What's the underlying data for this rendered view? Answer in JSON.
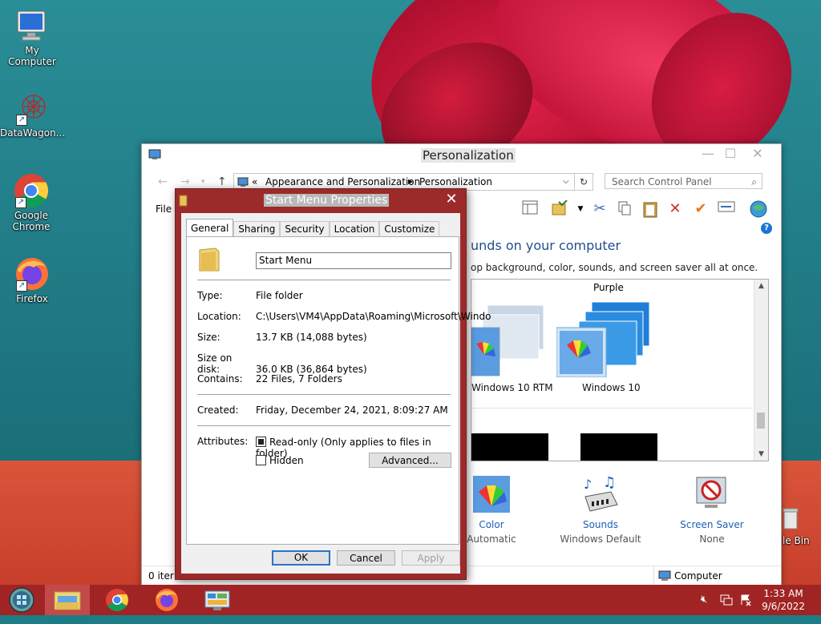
{
  "desktop": {
    "icons": [
      {
        "label": "My Computer"
      },
      {
        "label": "DataWagon..."
      },
      {
        "label": "Google Chrome"
      },
      {
        "label": "Firefox"
      }
    ],
    "recycle_bin_label": "le Bin"
  },
  "control_panel": {
    "title": "Personalization",
    "breadcrumb": {
      "prefix": "«",
      "parts": [
        "Appearance and Personalization",
        "Personalization"
      ]
    },
    "search_placeholder": "Search Control Panel",
    "file_menu": "File",
    "heading": "unds on your computer",
    "subheading": "op background, color, sounds, and screen saver all at once.",
    "theme_group_label": "Purple",
    "themes": [
      "Windows 10 RTM",
      "Windows 10"
    ],
    "bottom_items": [
      {
        "name": "Color",
        "value": "Automatic"
      },
      {
        "name": "Sounds",
        "value": "Windows Default"
      },
      {
        "name": "Screen Saver",
        "value": "None"
      }
    ],
    "status_left": "0 iter",
    "status_right": "Computer"
  },
  "dialog": {
    "title": "Start Menu Properties",
    "tabs": [
      "General",
      "Sharing",
      "Security",
      "Location",
      "Customize"
    ],
    "folder_name": "Start Menu",
    "fields": {
      "type_label": "Type:",
      "type_value": "File folder",
      "location_label": "Location:",
      "location_value": "C:\\Users\\VM4\\AppData\\Roaming\\Microsoft\\Windo",
      "size_label": "Size:",
      "size_value": "13.7 KB (14,088 bytes)",
      "size_on_disk_label": "Size on disk:",
      "size_on_disk_value": "36.0 KB (36,864 bytes)",
      "contains_label": "Contains:",
      "contains_value": "22 Files, 7 Folders",
      "created_label": "Created:",
      "created_value": "Friday, December 24, 2021, 8:09:27 AM",
      "attributes_label": "Attributes:"
    },
    "readonly_label": "Read-only (Only applies to files in folder)",
    "hidden_label": "Hidden",
    "advanced_label": "Advanced...",
    "ok_label": "OK",
    "cancel_label": "Cancel",
    "apply_label": "Apply"
  },
  "taskbar": {
    "time": "1:33 AM",
    "date": "9/6/2022"
  }
}
